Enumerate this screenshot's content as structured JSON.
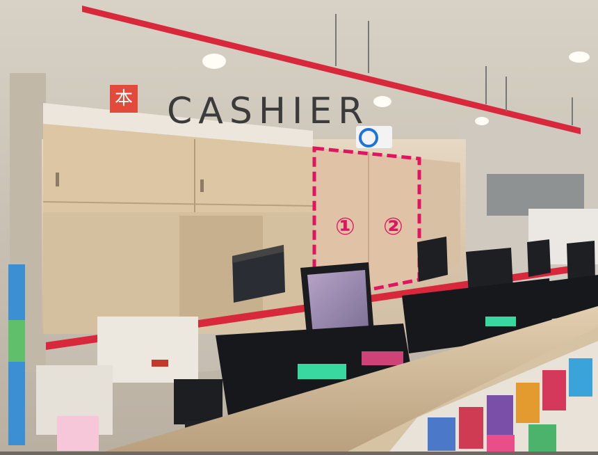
{
  "photo": {
    "sign_logo": "本",
    "sign_text": "CASHIER",
    "zone_labels": [
      "①",
      "②"
    ],
    "highlight_color": "#e0145f",
    "rail_color": "#d8283b"
  }
}
